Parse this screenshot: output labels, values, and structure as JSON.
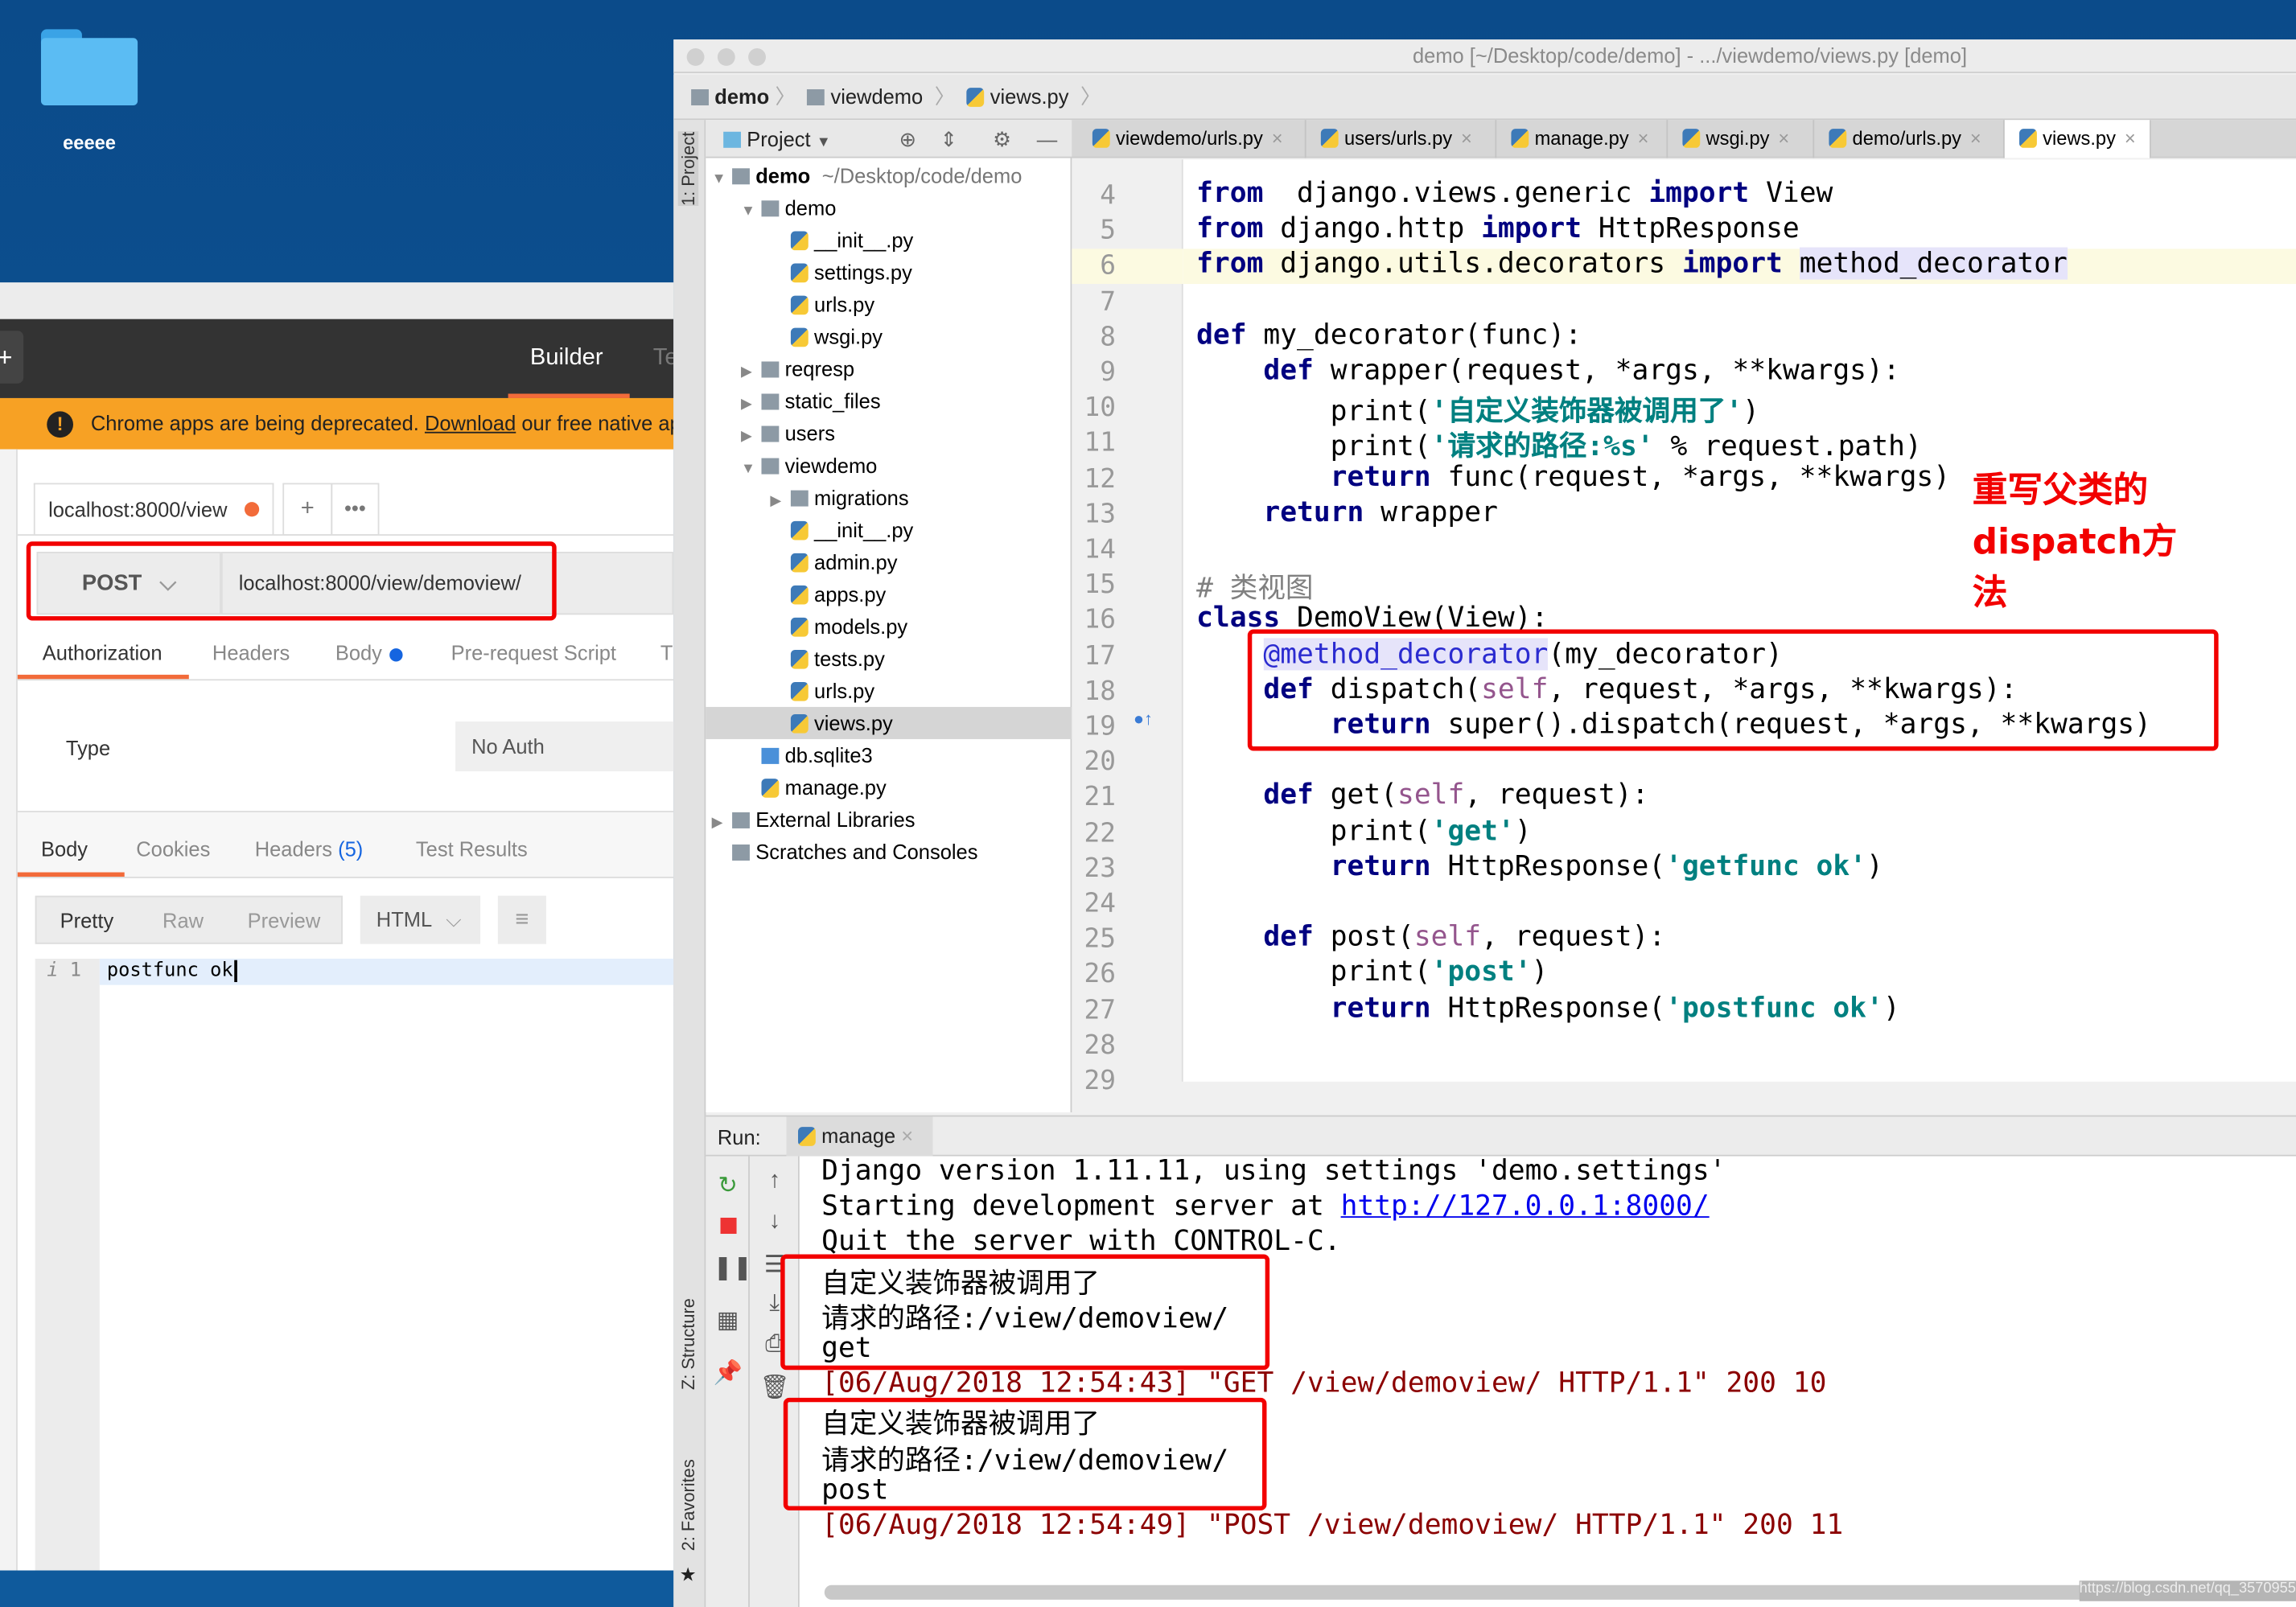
{
  "desktop": {
    "folder_label": "eeeee"
  },
  "postman": {
    "builder_tab": "Builder",
    "team_tab": "Te",
    "banner": {
      "text_before": "Chrome apps are being deprecated. ",
      "link": "Download",
      "text_after": " our free native ap"
    },
    "request_tab": "localhost:8000/view",
    "new_tab": "+",
    "more": "•••",
    "method": "POST",
    "url": "localhost:8000/view/demoview/",
    "request_tabs": [
      "Authorization",
      "Headers",
      "Body",
      "Pre-request Script",
      "T"
    ],
    "auth_type_label": "Type",
    "auth_type_value": "No Auth",
    "response_tabs": {
      "body": "Body",
      "cookies": "Cookies",
      "headers": "Headers",
      "headers_count": "(5)",
      "tests": "Test Results"
    },
    "format_buttons": [
      "Pretty",
      "Raw",
      "Preview"
    ],
    "format_select": "HTML",
    "response_line_number": "1",
    "response_body": "postfunc ok",
    "colors": {
      "accent": "#f26b3a",
      "banner": "#f7a124"
    }
  },
  "pycharm": {
    "title": "demo [~/Desktop/code/demo] - .../viewdemo/views.py [demo]",
    "breadcrumb": [
      "demo",
      "viewdemo",
      "views.py"
    ],
    "tool_strip": {
      "project": "1: Project",
      "structure": "Z: Structure",
      "favorites": "2: Favorites"
    },
    "project_panel": {
      "title": "Project",
      "tree": [
        {
          "label": "demo",
          "hint": "~/Desktop/code/demo",
          "depth": 0,
          "type": "folder",
          "arrow": "▼",
          "bold": true
        },
        {
          "label": "demo",
          "depth": 1,
          "type": "folder",
          "arrow": "▼"
        },
        {
          "label": "__init__.py",
          "depth": 2,
          "type": "py"
        },
        {
          "label": "settings.py",
          "depth": 2,
          "type": "py"
        },
        {
          "label": "urls.py",
          "depth": 2,
          "type": "py"
        },
        {
          "label": "wsgi.py",
          "depth": 2,
          "type": "py"
        },
        {
          "label": "reqresp",
          "depth": 1,
          "type": "folder",
          "arrow": "▶"
        },
        {
          "label": "static_files",
          "depth": 1,
          "type": "folder",
          "arrow": "▶"
        },
        {
          "label": "users",
          "depth": 1,
          "type": "folder",
          "arrow": "▶"
        },
        {
          "label": "viewdemo",
          "depth": 1,
          "type": "folder",
          "arrow": "▼"
        },
        {
          "label": "migrations",
          "depth": 2,
          "type": "folder",
          "arrow": "▶"
        },
        {
          "label": "__init__.py",
          "depth": 2,
          "type": "py"
        },
        {
          "label": "admin.py",
          "depth": 2,
          "type": "py"
        },
        {
          "label": "apps.py",
          "depth": 2,
          "type": "py"
        },
        {
          "label": "models.py",
          "depth": 2,
          "type": "py"
        },
        {
          "label": "tests.py",
          "depth": 2,
          "type": "py"
        },
        {
          "label": "urls.py",
          "depth": 2,
          "type": "py"
        },
        {
          "label": "views.py",
          "depth": 2,
          "type": "py",
          "selected": true
        },
        {
          "label": "db.sqlite3",
          "depth": 1,
          "type": "db"
        },
        {
          "label": "manage.py",
          "depth": 1,
          "type": "py"
        },
        {
          "label": "External Libraries",
          "depth": 0,
          "type": "lib",
          "arrow": "▶"
        },
        {
          "label": "Scratches and Consoles",
          "depth": 0,
          "type": "scratch"
        }
      ]
    },
    "editor_tabs": [
      {
        "label": "viewdemo/urls.py"
      },
      {
        "label": "users/urls.py"
      },
      {
        "label": "manage.py"
      },
      {
        "label": "wsgi.py"
      },
      {
        "label": "demo/urls.py"
      },
      {
        "label": "views.py",
        "active": true
      }
    ],
    "code_lines": [
      {
        "n": "4",
        "t": [
          [
            "kw",
            "from"
          ],
          [
            "",
            "  django.views.generic "
          ],
          [
            "kw",
            "import"
          ],
          [
            "",
            " View"
          ]
        ]
      },
      {
        "n": "5",
        "t": [
          [
            "kw",
            "from"
          ],
          [
            "",
            "",
            " "
          ],
          [
            "",
            " django.http "
          ],
          [
            "kw",
            "import"
          ],
          [
            "",
            " HttpResponse"
          ]
        ]
      },
      {
        "n": "6",
        "current": true,
        "t": [
          [
            "kw",
            "from"
          ],
          [
            "",
            " django.utils.decorators "
          ],
          [
            "kw",
            "import"
          ],
          [
            "",
            " "
          ],
          [
            "hl",
            "method_decorator"
          ]
        ]
      },
      {
        "n": "7",
        "t": []
      },
      {
        "n": "8",
        "t": [
          [
            "kw",
            "def"
          ],
          [
            "",
            " my_decorator(func):"
          ]
        ]
      },
      {
        "n": "9",
        "t": [
          [
            "",
            "    "
          ],
          [
            "kw",
            "def"
          ],
          [
            "",
            " wrapper(request, *args, **kwargs):"
          ]
        ]
      },
      {
        "n": "10",
        "t": [
          [
            "",
            "        print("
          ],
          [
            "str",
            "'自定义装饰器被调用了'"
          ],
          [
            "",
            ")"
          ]
        ]
      },
      {
        "n": "11",
        "t": [
          [
            "",
            "        print("
          ],
          [
            "str",
            "'请求的路径:%s'"
          ],
          [
            "",
            " % request.path)"
          ]
        ]
      },
      {
        "n": "12",
        "t": [
          [
            "",
            "        "
          ],
          [
            "kw",
            "return"
          ],
          [
            "",
            " func(request, *args, **kwargs)"
          ]
        ]
      },
      {
        "n": "13",
        "t": [
          [
            "",
            "    "
          ],
          [
            "kw",
            "return"
          ],
          [
            "",
            " wrapper"
          ]
        ]
      },
      {
        "n": "14",
        "t": []
      },
      {
        "n": "15",
        "t": [
          [
            "cmt",
            "# 类视图"
          ]
        ]
      },
      {
        "n": "16",
        "t": [
          [
            "kw",
            "class"
          ],
          [
            "",
            " DemoView(View):"
          ]
        ]
      },
      {
        "n": "17",
        "t": [
          [
            "",
            "    "
          ],
          [
            "deco",
            "@method_decorator"
          ],
          [
            "",
            "(my_decorator)"
          ]
        ]
      },
      {
        "n": "18",
        "t": [
          [
            "",
            "    "
          ],
          [
            "kw",
            "def"
          ],
          [
            "",
            " dispatch("
          ],
          [
            "self",
            "self"
          ],
          [
            "",
            ", request, *args, **kwargs):"
          ]
        ]
      },
      {
        "n": "19",
        "t": [
          [
            "",
            "        "
          ],
          [
            "kw",
            "return"
          ],
          [
            "",
            " super().dispatch(request, *args, **kwargs)"
          ]
        ]
      },
      {
        "n": "20",
        "t": []
      },
      {
        "n": "21",
        "t": [
          [
            "",
            "    "
          ],
          [
            "kw",
            "def"
          ],
          [
            "",
            " get("
          ],
          [
            "self",
            "self"
          ],
          [
            "",
            ", request):"
          ]
        ]
      },
      {
        "n": "22",
        "t": [
          [
            "",
            "        print("
          ],
          [
            "str",
            "'get'"
          ],
          [
            "",
            ")"
          ]
        ]
      },
      {
        "n": "23",
        "t": [
          [
            "",
            "        "
          ],
          [
            "kw",
            "return"
          ],
          [
            "",
            " HttpResponse("
          ],
          [
            "str",
            "'getfunc ok'"
          ],
          [
            "",
            ")"
          ]
        ]
      },
      {
        "n": "24",
        "t": []
      },
      {
        "n": "25",
        "t": [
          [
            "",
            "    "
          ],
          [
            "kw",
            "def"
          ],
          [
            "",
            " post("
          ],
          [
            "self",
            "self"
          ],
          [
            "",
            ", request):"
          ]
        ]
      },
      {
        "n": "26",
        "t": [
          [
            "",
            "        print("
          ],
          [
            "str",
            "'post'"
          ],
          [
            "",
            ")"
          ]
        ]
      },
      {
        "n": "27",
        "t": [
          [
            "",
            "        "
          ],
          [
            "kw",
            "return"
          ],
          [
            "",
            " HttpResponse("
          ],
          [
            "str",
            "'postfunc ok'"
          ],
          [
            "",
            ")"
          ]
        ]
      },
      {
        "n": "28",
        "t": []
      },
      {
        "n": "29",
        "t": []
      }
    ],
    "annotation": "重写父类的dispatch方法",
    "run": {
      "label": "Run:",
      "tab": "manage",
      "console": [
        {
          "text": "Django version 1.11.11, using settings 'demo.settings'"
        },
        {
          "text": "Starting development server at ",
          "link": "http://127.0.0.1:8000/"
        },
        {
          "text": "Quit the server with CONTROL-C."
        },
        {
          "text": "自定义装饰器被调用了"
        },
        {
          "text": "请求的路径:/view/demoview/"
        },
        {
          "text": "get"
        },
        {
          "text": "[06/Aug/2018 12:54:43] \"GET /view/demoview/ HTTP/1.1\" 200 10",
          "err": true
        },
        {
          "text": "自定义装饰器被调用了"
        },
        {
          "text": "请求的路径:/view/demoview/"
        },
        {
          "text": "post"
        },
        {
          "text": "[06/Aug/2018 12:54:49] \"POST /view/demoview/ HTTP/1.1\" 200 11",
          "err": true
        }
      ]
    }
  },
  "watermark": "https://blog.csdn.net/qq_35709559",
  "colors": {
    "annotation": "#f20000",
    "keyword": "#000080",
    "string": "#008080"
  }
}
